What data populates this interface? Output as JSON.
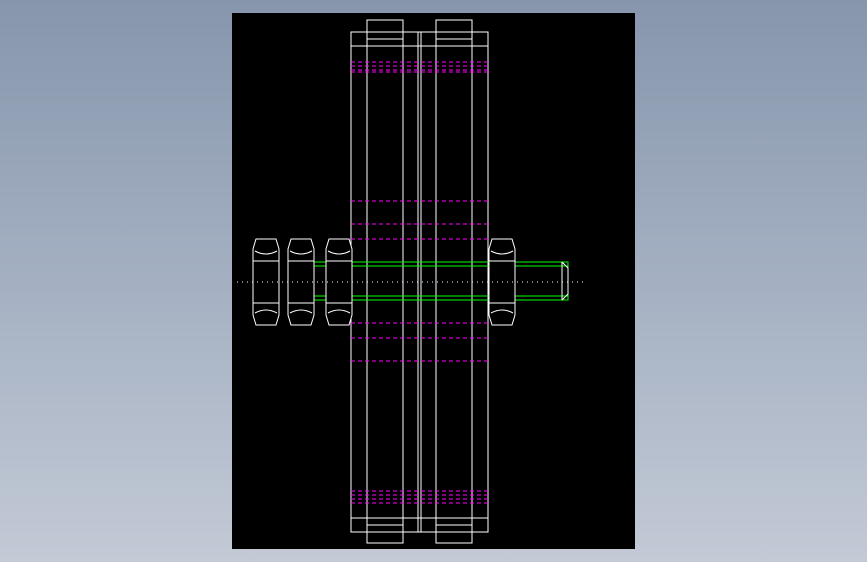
{
  "drawing": {
    "colors": {
      "background_outer": "#98a4b8",
      "viewport": "#000000",
      "outline": "#ffffff",
      "hidden_lines": "#ff00ff",
      "bolt": "#00ff00",
      "centerline": "#ffffff"
    },
    "components": [
      {
        "name": "bolt-head",
        "kind": "hex-nut"
      },
      {
        "name": "nut-1",
        "kind": "hex-nut"
      },
      {
        "name": "nut-2",
        "kind": "hex-nut"
      },
      {
        "name": "nut-3",
        "kind": "hex-nut"
      },
      {
        "name": "threaded-rod",
        "kind": "bolt"
      },
      {
        "name": "wheel-left",
        "kind": "roller"
      },
      {
        "name": "wheel-right",
        "kind": "roller"
      }
    ]
  }
}
